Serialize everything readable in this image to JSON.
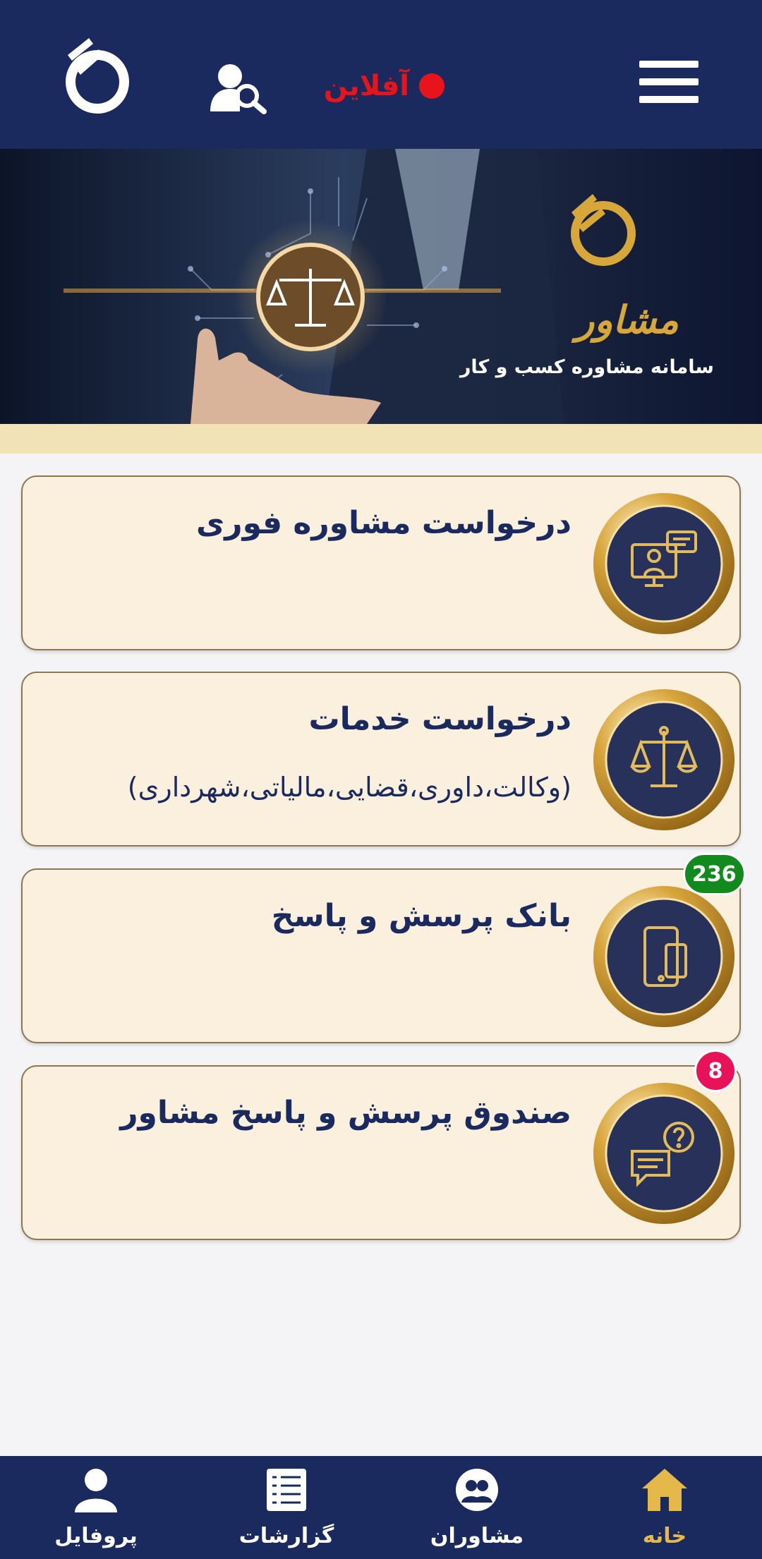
{
  "header": {
    "status_text": "آفلاین",
    "status_color": "#e8141c",
    "menu_icon": "hamburger-icon",
    "search_icon": "user-search-icon",
    "logo_icon": "app-logo-icon",
    "bg_color": "#1b2a5e"
  },
  "banner": {
    "brand": "مشاور",
    "subtitle": "سامانه مشاوره کسب و کار",
    "accent": "#d7a73a"
  },
  "cards": [
    {
      "title": "درخواست مشاوره فوری",
      "subtitle": "",
      "icon": "video-consult-icon",
      "badge": null
    },
    {
      "title": "درخواست خدمات",
      "subtitle": "(وکالت،داوری،قضایی،مالیاتی،شهرداری)",
      "icon": "scales-icon",
      "badge": null
    },
    {
      "title": "بانک پرسش و پاسخ",
      "subtitle": "",
      "icon": "mobile-devices-icon",
      "badge": "236",
      "badge_color": "#128a1e"
    },
    {
      "title": "صندوق پرسش و پاسخ مشاور",
      "subtitle": "",
      "icon": "question-chat-icon",
      "badge": "8",
      "badge_color": "#e8125a"
    }
  ],
  "bottom_nav": [
    {
      "label": "خانه",
      "icon": "home-icon",
      "active": true
    },
    {
      "label": "مشاوران",
      "icon": "advisors-icon",
      "active": false
    },
    {
      "label": "گزارشات",
      "icon": "reports-icon",
      "active": false
    },
    {
      "label": "پروفایل",
      "icon": "profile-icon",
      "active": false
    }
  ]
}
